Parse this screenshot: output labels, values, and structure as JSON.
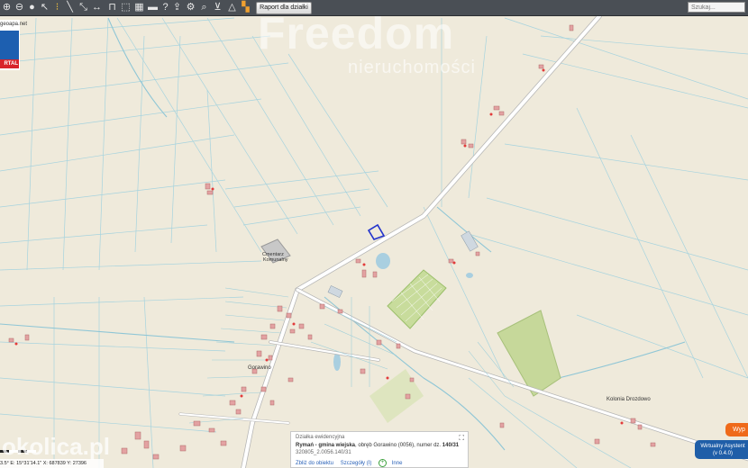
{
  "toolbar": {
    "report_button": "Raport dla działki",
    "search_placeholder": "Szukaj...",
    "icons": [
      "zoom-in-icon",
      "zoom-out-icon",
      "circle-icon",
      "cursor-icon",
      "marker-icon",
      "measure-line-icon",
      "measure-distance-icon",
      "measure-width-icon",
      "lock-icon",
      "select-icon",
      "grid-icon",
      "car-icon",
      "help-icon",
      "upload-icon",
      "settings-icon",
      "search-icon",
      "cart-icon",
      "warning-icon",
      "layers-icon"
    ]
  },
  "logo": {
    "url_text": "geoapa.net",
    "label": "RTAL"
  },
  "watermark": {
    "brand": "Freedom",
    "subtitle": "nieruchomości"
  },
  "labels": {
    "cemetery_line1": "Cmentarz",
    "cemetery_line2": "Komunalny",
    "village": "Gorawino",
    "colony": "Kolonia Drozdowo"
  },
  "coords": "3.5° E: 15°31'14.1\"  X: 687839  Y: 27396",
  "okolica": "okolica.pl",
  "popup": {
    "title": "Działka ewidencyjna",
    "commune": "Rymań - gmina wiejska",
    "precinct_prefix": ", obręb Gorawino (0056), numer dz.",
    "parcel_number": "140/31",
    "code": "320805_2.0056.140/31",
    "link_zoom": "Zbliż do obiektu",
    "link_details": "Szczegóły (I)",
    "link_other": "Inne"
  },
  "buttons": {
    "orange": "Wyp",
    "virtual_line1": "Wirtualny Asystent",
    "virtual_line2": "(v 0.4.0)"
  },
  "colors": {
    "map_bg": "#efeadb",
    "water": "#a9cfe0",
    "road": "#ffffff",
    "parcel_line": "#9fd0dc",
    "building": "#e0a0a0",
    "highlight": "#2233cc",
    "green_area": "#c6d89a"
  }
}
